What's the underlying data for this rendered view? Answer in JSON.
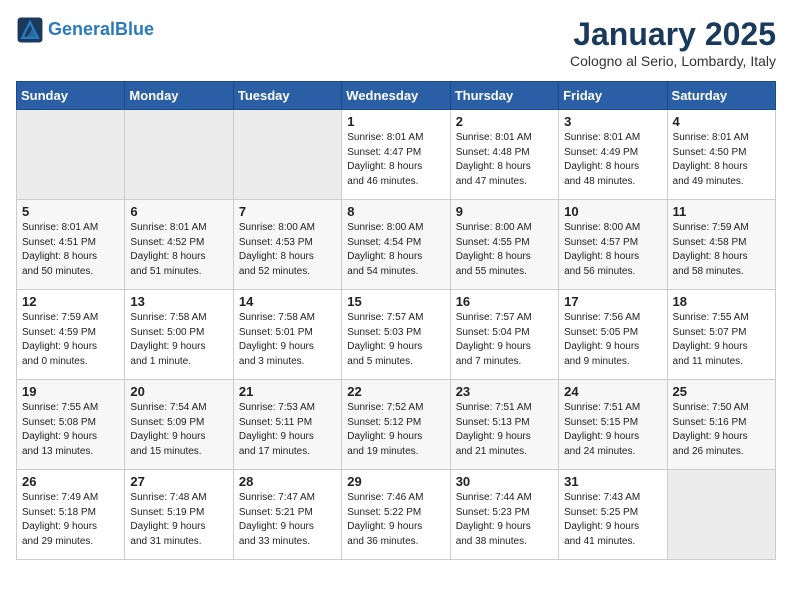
{
  "logo": {
    "line1": "General",
    "line2": "Blue"
  },
  "title": "January 2025",
  "subtitle": "Cologno al Serio, Lombardy, Italy",
  "days_of_week": [
    "Sunday",
    "Monday",
    "Tuesday",
    "Wednesday",
    "Thursday",
    "Friday",
    "Saturday"
  ],
  "weeks": [
    [
      {
        "day": "",
        "info": ""
      },
      {
        "day": "",
        "info": ""
      },
      {
        "day": "",
        "info": ""
      },
      {
        "day": "1",
        "info": "Sunrise: 8:01 AM\nSunset: 4:47 PM\nDaylight: 8 hours\nand 46 minutes."
      },
      {
        "day": "2",
        "info": "Sunrise: 8:01 AM\nSunset: 4:48 PM\nDaylight: 8 hours\nand 47 minutes."
      },
      {
        "day": "3",
        "info": "Sunrise: 8:01 AM\nSunset: 4:49 PM\nDaylight: 8 hours\nand 48 minutes."
      },
      {
        "day": "4",
        "info": "Sunrise: 8:01 AM\nSunset: 4:50 PM\nDaylight: 8 hours\nand 49 minutes."
      }
    ],
    [
      {
        "day": "5",
        "info": "Sunrise: 8:01 AM\nSunset: 4:51 PM\nDaylight: 8 hours\nand 50 minutes."
      },
      {
        "day": "6",
        "info": "Sunrise: 8:01 AM\nSunset: 4:52 PM\nDaylight: 8 hours\nand 51 minutes."
      },
      {
        "day": "7",
        "info": "Sunrise: 8:00 AM\nSunset: 4:53 PM\nDaylight: 8 hours\nand 52 minutes."
      },
      {
        "day": "8",
        "info": "Sunrise: 8:00 AM\nSunset: 4:54 PM\nDaylight: 8 hours\nand 54 minutes."
      },
      {
        "day": "9",
        "info": "Sunrise: 8:00 AM\nSunset: 4:55 PM\nDaylight: 8 hours\nand 55 minutes."
      },
      {
        "day": "10",
        "info": "Sunrise: 8:00 AM\nSunset: 4:57 PM\nDaylight: 8 hours\nand 56 minutes."
      },
      {
        "day": "11",
        "info": "Sunrise: 7:59 AM\nSunset: 4:58 PM\nDaylight: 8 hours\nand 58 minutes."
      }
    ],
    [
      {
        "day": "12",
        "info": "Sunrise: 7:59 AM\nSunset: 4:59 PM\nDaylight: 9 hours\nand 0 minutes."
      },
      {
        "day": "13",
        "info": "Sunrise: 7:58 AM\nSunset: 5:00 PM\nDaylight: 9 hours\nand 1 minute."
      },
      {
        "day": "14",
        "info": "Sunrise: 7:58 AM\nSunset: 5:01 PM\nDaylight: 9 hours\nand 3 minutes."
      },
      {
        "day": "15",
        "info": "Sunrise: 7:57 AM\nSunset: 5:03 PM\nDaylight: 9 hours\nand 5 minutes."
      },
      {
        "day": "16",
        "info": "Sunrise: 7:57 AM\nSunset: 5:04 PM\nDaylight: 9 hours\nand 7 minutes."
      },
      {
        "day": "17",
        "info": "Sunrise: 7:56 AM\nSunset: 5:05 PM\nDaylight: 9 hours\nand 9 minutes."
      },
      {
        "day": "18",
        "info": "Sunrise: 7:55 AM\nSunset: 5:07 PM\nDaylight: 9 hours\nand 11 minutes."
      }
    ],
    [
      {
        "day": "19",
        "info": "Sunrise: 7:55 AM\nSunset: 5:08 PM\nDaylight: 9 hours\nand 13 minutes."
      },
      {
        "day": "20",
        "info": "Sunrise: 7:54 AM\nSunset: 5:09 PM\nDaylight: 9 hours\nand 15 minutes."
      },
      {
        "day": "21",
        "info": "Sunrise: 7:53 AM\nSunset: 5:11 PM\nDaylight: 9 hours\nand 17 minutes."
      },
      {
        "day": "22",
        "info": "Sunrise: 7:52 AM\nSunset: 5:12 PM\nDaylight: 9 hours\nand 19 minutes."
      },
      {
        "day": "23",
        "info": "Sunrise: 7:51 AM\nSunset: 5:13 PM\nDaylight: 9 hours\nand 21 minutes."
      },
      {
        "day": "24",
        "info": "Sunrise: 7:51 AM\nSunset: 5:15 PM\nDaylight: 9 hours\nand 24 minutes."
      },
      {
        "day": "25",
        "info": "Sunrise: 7:50 AM\nSunset: 5:16 PM\nDaylight: 9 hours\nand 26 minutes."
      }
    ],
    [
      {
        "day": "26",
        "info": "Sunrise: 7:49 AM\nSunset: 5:18 PM\nDaylight: 9 hours\nand 29 minutes."
      },
      {
        "day": "27",
        "info": "Sunrise: 7:48 AM\nSunset: 5:19 PM\nDaylight: 9 hours\nand 31 minutes."
      },
      {
        "day": "28",
        "info": "Sunrise: 7:47 AM\nSunset: 5:21 PM\nDaylight: 9 hours\nand 33 minutes."
      },
      {
        "day": "29",
        "info": "Sunrise: 7:46 AM\nSunset: 5:22 PM\nDaylight: 9 hours\nand 36 minutes."
      },
      {
        "day": "30",
        "info": "Sunrise: 7:44 AM\nSunset: 5:23 PM\nDaylight: 9 hours\nand 38 minutes."
      },
      {
        "day": "31",
        "info": "Sunrise: 7:43 AM\nSunset: 5:25 PM\nDaylight: 9 hours\nand 41 minutes."
      },
      {
        "day": "",
        "info": ""
      }
    ]
  ]
}
